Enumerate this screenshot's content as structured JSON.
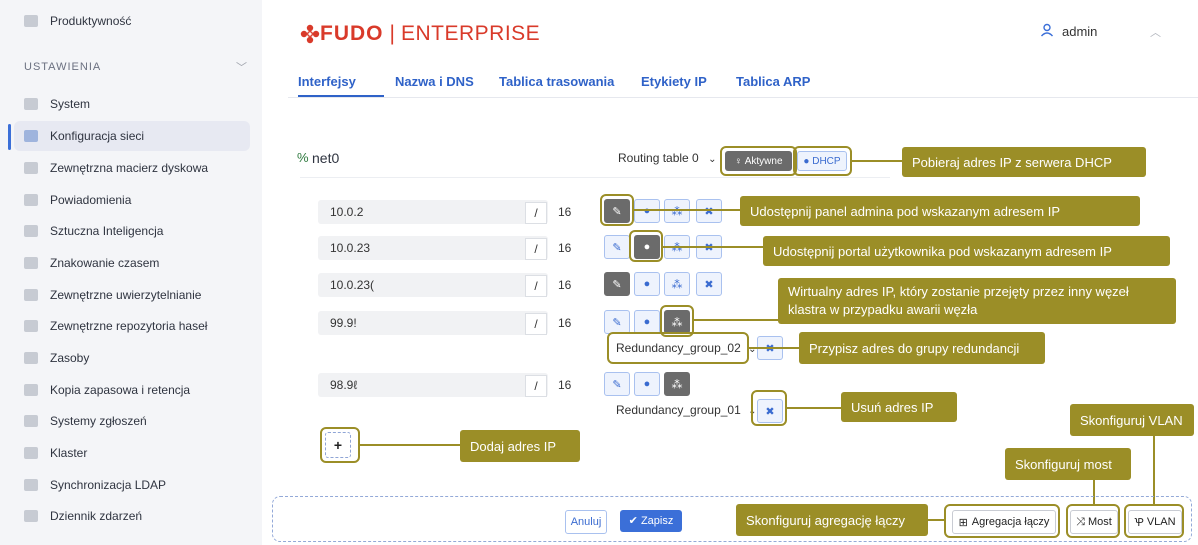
{
  "sidebar": {
    "top_item": "Produktywność",
    "section": "USTAWIENIA",
    "items": [
      {
        "label": "System"
      },
      {
        "label": "Konfiguracja sieci"
      },
      {
        "label": "Zewnętrzna macierz dyskowa"
      },
      {
        "label": "Powiadomienia"
      },
      {
        "label": "Sztuczna Inteligencja"
      },
      {
        "label": "Znakowanie czasem"
      },
      {
        "label": "Zewnętrzne uwierzytelnianie"
      },
      {
        "label": "Zewnętrzne repozytoria haseł"
      },
      {
        "label": "Zasoby"
      },
      {
        "label": "Kopia zapasowa i retencja"
      },
      {
        "label": "Systemy zgłoszeń"
      },
      {
        "label": "Klaster"
      },
      {
        "label": "Synchronizacja LDAP"
      },
      {
        "label": "Dziennik zdarzeń"
      }
    ]
  },
  "header": {
    "logo_main": "FUDO",
    "logo_sep": "|",
    "logo_edition": "ENTERPRISE",
    "user": "admin"
  },
  "tabs": [
    "Interfejsy",
    "Nazwa i DNS",
    "Tablica trasowania",
    "Etykiety IP",
    "Tablica ARP"
  ],
  "interface": {
    "name": "net0",
    "routing": "Routing table 0",
    "active_label": "Aktywne",
    "dhcp_label": "DHCP",
    "addresses": [
      {
        "ip": "10.0.2",
        "mask": "16"
      },
      {
        "ip": "10.0.23",
        "mask": "16"
      },
      {
        "ip": "10.0.23(",
        "mask": "16"
      },
      {
        "ip": "99.9!",
        "mask": "16",
        "group": "Redundancy_group_02"
      },
      {
        "ip": "98.9ℓ",
        "mask": "16",
        "group": "Redundancy_group_01"
      }
    ],
    "slash": "/"
  },
  "callouts": {
    "dhcp": "Pobieraj adres IP z serwera DHCP",
    "admin": "Udostępnij panel admina pod wskazanym adresem IP",
    "portal": "Udostępnij portal użytkownika pod wskazanym adresem IP",
    "virtual": "Wirtualny adres IP, który zostanie przejęty przez inny węzeł klastra w przypadku awarii węzła",
    "group": "Przypisz adres do grupy redundancji",
    "remove": "Usuń adres IP",
    "add": "Dodaj adres IP",
    "vlan": "Skonfiguruj VLAN",
    "bridge": "Skonfiguruj most",
    "lag": "Skonfiguruj agregację łączy"
  },
  "footer": {
    "cancel": "Anuluj",
    "save": "Zapisz",
    "lag": "Agregacja łączy",
    "bridge": "Most",
    "vlan": "VLAN"
  },
  "colors": {
    "accent": "#3b6fd8",
    "brand": "#d93a2a",
    "callout": "#9b8e27"
  }
}
